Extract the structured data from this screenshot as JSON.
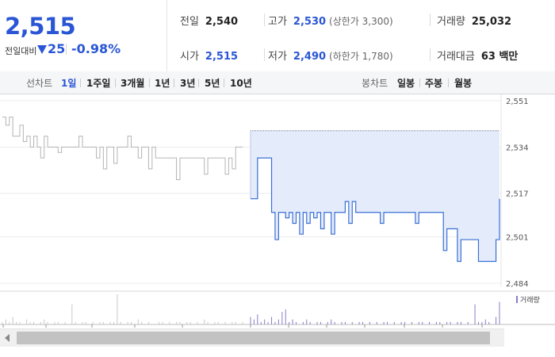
{
  "summary": {
    "current_price": "2,515",
    "compare_label": "전일대비",
    "change_value": "25",
    "change_rate": "-0.98%",
    "prev_close_label": "전일",
    "prev_close": "2,540",
    "high_label": "고가",
    "high": "2,530",
    "upper_limit": "(상한가 3,300)",
    "volume_label": "거래량",
    "volume": "25,032",
    "open_label": "시가",
    "open": "2,515",
    "low_label": "저가",
    "low": "2,490",
    "lower_limit": "(하한가 1,780)",
    "amount_label": "거래대금",
    "amount": "63 백만"
  },
  "tabs": {
    "line_label": "선차트",
    "line_tabs": [
      "1일",
      "1주일",
      "3개월",
      "1년",
      "3년",
      "5년",
      "10년"
    ],
    "active_line_tab": 0,
    "candle_label": "봉차트",
    "candle_tabs": [
      "일봉",
      "주봉",
      "월봉"
    ]
  },
  "chart_data": {
    "type": "line",
    "y_ticks": [
      "2,551",
      "2,534",
      "2,517",
      "2,501",
      "2,484"
    ],
    "ylim": [
      2484,
      2551
    ],
    "volume_legend": "거래량",
    "colors": {
      "prev_day": "#b5b5b5",
      "today": "#3a6fd6",
      "fill": "#e4ecfb",
      "volume": "#8b7cc6"
    },
    "prev_day_series": [
      2545,
      2542,
      2545,
      2538,
      2538,
      2542,
      2536,
      2538,
      2534,
      2538,
      2534,
      2530,
      2538,
      2534,
      2534,
      2534,
      2532,
      2534,
      2534,
      2534,
      2534,
      2534,
      2538,
      2534,
      2534,
      2534,
      2534,
      2530,
      2534,
      2526,
      2534,
      2534,
      2528,
      2534,
      2534,
      2534,
      2538,
      2534,
      2534,
      2530,
      2534,
      2534,
      2526,
      2534,
      2530,
      2530,
      2530,
      2530,
      2530,
      2530,
      2522,
      2530,
      2530,
      2530,
      2530,
      2530,
      2530,
      2530,
      2524,
      2530,
      2530,
      2530,
      2530,
      2530,
      2524,
      2530,
      2526,
      2534,
      2534,
      2534
    ],
    "prev_close": 2540,
    "today_series": [
      2515,
      2515,
      2530,
      2530,
      2530,
      2530,
      2510,
      2500,
      2510,
      2510,
      2508,
      2510,
      2506,
      2510,
      2502,
      2510,
      2506,
      2510,
      2508,
      2510,
      2504,
      2510,
      2510,
      2502,
      2510,
      2510,
      2510,
      2514,
      2506,
      2514,
      2510,
      2510,
      2510,
      2510,
      2510,
      2510,
      2510,
      2506,
      2510,
      2510,
      2510,
      2510,
      2510,
      2510,
      2510,
      2510,
      2510,
      2506,
      2510,
      2510,
      2510,
      2510,
      2510,
      2510,
      2510,
      2496,
      2504,
      2504,
      2504,
      2492,
      2500,
      2500,
      2500,
      2500,
      2500,
      2492,
      2492,
      2492,
      2492,
      2492,
      2500,
      2515
    ],
    "volume_prev": [
      1,
      2,
      1,
      3,
      1,
      1,
      0,
      2,
      1,
      1,
      0,
      1,
      2,
      1,
      0,
      1,
      1,
      0,
      1,
      0,
      8,
      1,
      0,
      1,
      1,
      0,
      1,
      0,
      1,
      1,
      0,
      1,
      1,
      12,
      1,
      0,
      1,
      1,
      0,
      2,
      1,
      0,
      1,
      0,
      0,
      1,
      1,
      0,
      1,
      0,
      1,
      1,
      0,
      1,
      1,
      0,
      1,
      0,
      2,
      1,
      0,
      1,
      1,
      0,
      1,
      0,
      1,
      1,
      0,
      1
    ],
    "volume_today": [
      3,
      2,
      4,
      1,
      2,
      1,
      3,
      1,
      2,
      5,
      6,
      1,
      2,
      1,
      0,
      1,
      2,
      1,
      0,
      1,
      1,
      0,
      1,
      2,
      1,
      0,
      1,
      1,
      0,
      1,
      0,
      1,
      1,
      0,
      1,
      0,
      1,
      0,
      1,
      1,
      0,
      1,
      0,
      1,
      1,
      0,
      1,
      0,
      1,
      1,
      0,
      1,
      0,
      1,
      1,
      0,
      1,
      1,
      0,
      1,
      1,
      0,
      1,
      0,
      8,
      1,
      1,
      2,
      1,
      0,
      3,
      9
    ]
  }
}
